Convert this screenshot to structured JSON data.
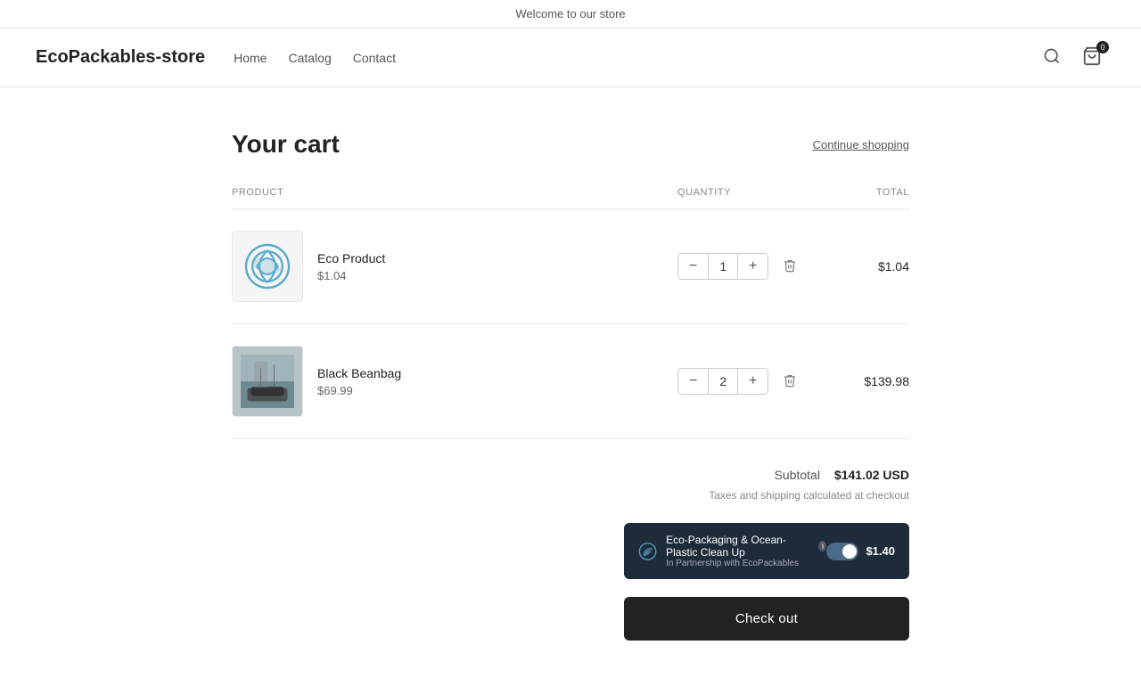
{
  "banner": {
    "text": "Welcome to our store"
  },
  "header": {
    "store_name": "EcoPackables-store",
    "nav": [
      {
        "label": "Home",
        "id": "home"
      },
      {
        "label": "Catalog",
        "id": "catalog"
      },
      {
        "label": "Contact",
        "id": "contact"
      }
    ],
    "cart_count": "0"
  },
  "cart": {
    "title": "Your cart",
    "continue_shopping": "Continue shopping",
    "columns": {
      "product": "Product",
      "quantity": "Quantity",
      "total": "Total"
    },
    "items": [
      {
        "id": "eco-product",
        "name": "Eco Product",
        "price": "$1.04",
        "quantity": 1,
        "total": "$1.04",
        "image_type": "eco-svg"
      },
      {
        "id": "black-beanbag",
        "name": "Black Beanbag",
        "price": "$69.99",
        "quantity": 2,
        "total": "$139.98",
        "image_type": "beanbag"
      }
    ],
    "subtotal_label": "Subtotal",
    "subtotal_value": "$141.02 USD",
    "tax_note": "Taxes and shipping calculated at checkout",
    "eco_packaging": {
      "text": "Eco-Packaging & Ocean-Plastic Clean Up",
      "subtext": "In Partnership with EcoPackables",
      "price": "$1.40"
    },
    "checkout_label": "Check out"
  }
}
